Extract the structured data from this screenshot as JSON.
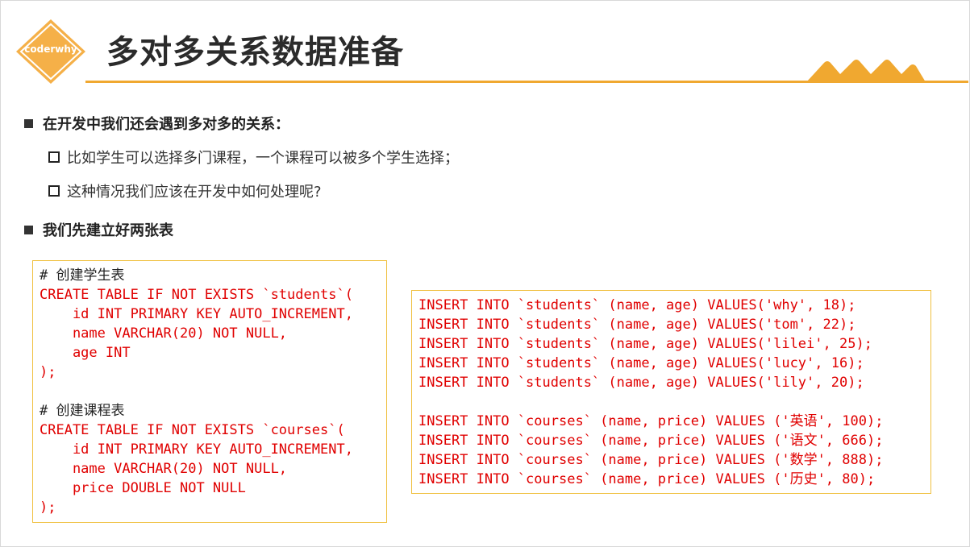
{
  "header": {
    "logo_text": "coderwhy",
    "title": "多对多关系数据准备"
  },
  "bullets": {
    "b1": "在开发中我们还会遇到多对多的关系：",
    "b1_sub1": "比如学生可以选择多门课程，一个课程可以被多个学生选择；",
    "b1_sub2": "这种情况我们应该在开发中如何处理呢?",
    "b2": "我们先建立好两张表"
  },
  "code_left": {
    "lines": [
      {
        "text": "# 创建学生表",
        "style": "dark"
      },
      {
        "text": "CREATE TABLE IF NOT EXISTS `students`(",
        "style": "red"
      },
      {
        "text": "    id INT PRIMARY KEY AUTO_INCREMENT,",
        "style": "red"
      },
      {
        "text": "    name VARCHAR(20) NOT NULL,",
        "style": "red"
      },
      {
        "text": "    age INT",
        "style": "red"
      },
      {
        "text": ");",
        "style": "red"
      },
      {
        "text": "",
        "style": "red"
      },
      {
        "text": "# 创建课程表",
        "style": "dark"
      },
      {
        "text": "CREATE TABLE IF NOT EXISTS `courses`(",
        "style": "red"
      },
      {
        "text": "    id INT PRIMARY KEY AUTO_INCREMENT,",
        "style": "red"
      },
      {
        "text": "    name VARCHAR(20) NOT NULL,",
        "style": "red"
      },
      {
        "text": "    price DOUBLE NOT NULL",
        "style": "red"
      },
      {
        "text": ");",
        "style": "red"
      }
    ]
  },
  "code_right": {
    "lines": [
      {
        "text": "INSERT INTO `students` (name, age) VALUES('why', 18);",
        "style": "red"
      },
      {
        "text": "INSERT INTO `students` (name, age) VALUES('tom', 22);",
        "style": "red"
      },
      {
        "text": "INSERT INTO `students` (name, age) VALUES('lilei', 25);",
        "style": "red"
      },
      {
        "text": "INSERT INTO `students` (name, age) VALUES('lucy', 16);",
        "style": "red"
      },
      {
        "text": "INSERT INTO `students` (name, age) VALUES('lily', 20);",
        "style": "red"
      },
      {
        "text": "",
        "style": "red"
      },
      {
        "text": "INSERT INTO `courses` (name, price) VALUES ('英语', 100);",
        "style": "red"
      },
      {
        "text": "INSERT INTO `courses` (name, price) VALUES ('语文', 666);",
        "style": "red"
      },
      {
        "text": "INSERT INTO `courses` (name, price) VALUES ('数学', 888);",
        "style": "red"
      },
      {
        "text": "INSERT INTO `courses` (name, price) VALUES ('历史', 80);",
        "style": "red"
      }
    ]
  },
  "colors": {
    "accent": "#f0a830",
    "code_text": "#e00000",
    "code_border": "#f0c040"
  }
}
